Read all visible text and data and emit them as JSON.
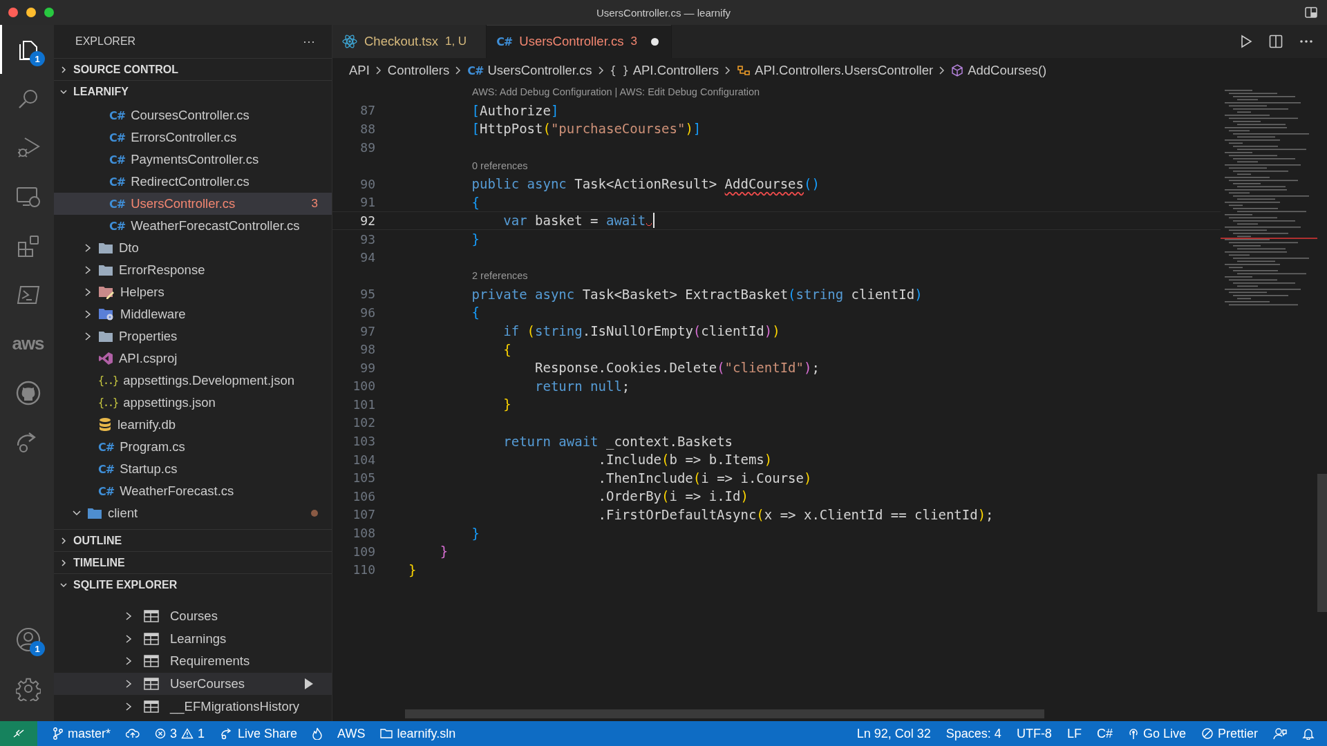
{
  "window": {
    "title": "UsersController.cs — learnify"
  },
  "activity_bar": {
    "top": [
      {
        "kind": "explorer",
        "selected": true,
        "badge": "1"
      },
      {
        "kind": "search",
        "selected": false
      },
      {
        "kind": "debug",
        "selected": false
      },
      {
        "kind": "remote",
        "selected": false
      },
      {
        "kind": "extensions",
        "selected": false
      },
      {
        "kind": "terminal",
        "selected": false
      },
      {
        "kind": "aws",
        "label": "aws",
        "selected": false
      },
      {
        "kind": "github",
        "selected": false
      },
      {
        "kind": "liveshare",
        "selected": false
      }
    ],
    "bottom": [
      {
        "kind": "account",
        "selected": false,
        "badge": "1"
      },
      {
        "kind": "settings",
        "selected": false
      }
    ]
  },
  "sidebar": {
    "title": "EXPLORER",
    "more": "···",
    "sections": [
      {
        "title": "SOURCE CONTROL",
        "expanded": false
      },
      {
        "title": "LEARNIFY",
        "expanded": true,
        "kind": "files",
        "tree": [
          {
            "kind": "group",
            "children": [
              {
                "kind": "group",
                "children": [
                  {
                    "label": "CoursesController.cs",
                    "kind": "cs",
                    "icon_text": "C#",
                    "selected": false
                  },
                  {
                    "label": "ErrorsController.cs",
                    "kind": "cs",
                    "icon_text": "C#",
                    "selected": false
                  },
                  {
                    "label": "PaymentsController.cs",
                    "kind": "cs",
                    "icon_text": "C#",
                    "selected": false
                  },
                  {
                    "label": "RedirectController.cs",
                    "kind": "cs",
                    "icon_text": "C#",
                    "selected": false
                  },
                  {
                    "label": "UsersController.cs",
                    "kind": "cs",
                    "icon_text": "C#",
                    "selected": true,
                    "errors": "3"
                  },
                  {
                    "label": "WeatherForecastController.cs",
                    "kind": "cs",
                    "icon_text": "C#",
                    "selected": false
                  }
                ]
              },
              {
                "label": "Dto",
                "kind": "folder",
                "expanded": false,
                "selected": false
              },
              {
                "label": "ErrorResponse",
                "kind": "folder",
                "expanded": false,
                "selected": false
              },
              {
                "label": "Helpers",
                "kind": "folder-helpers",
                "expanded": false,
                "selected": false
              },
              {
                "label": "Middleware",
                "kind": "folder-middleware",
                "expanded": false,
                "selected": false
              },
              {
                "label": "Properties",
                "kind": "folder",
                "expanded": false,
                "selected": false
              },
              {
                "label": "API.csproj",
                "kind": "csproj",
                "selected": false
              },
              {
                "label": "appsettings.Development.json",
                "kind": "json",
                "icon_text": "{..}",
                "selected": false
              },
              {
                "label": "appsettings.json",
                "kind": "json",
                "icon_text": "{..}",
                "selected": false
              },
              {
                "label": "learnify.db",
                "kind": "db",
                "selected": false
              },
              {
                "label": "Program.cs",
                "kind": "cs",
                "icon_text": "C#",
                "selected": false
              },
              {
                "label": "Startup.cs",
                "kind": "cs",
                "icon_text": "C#",
                "selected": false
              },
              {
                "label": "WeatherForecast.cs",
                "kind": "cs",
                "icon_text": "C#",
                "selected": false
              }
            ]
          },
          {
            "label": "client",
            "kind": "folder-client",
            "expanded": true,
            "selected": false,
            "modified": true
          }
        ]
      },
      {
        "title": "OUTLINE",
        "expanded": false
      },
      {
        "title": "TIMELINE",
        "expanded": false
      },
      {
        "title": "SQLITE EXPLORER",
        "expanded": true,
        "kind": "tables",
        "tables": [
          {
            "label": "Courses",
            "selected": false
          },
          {
            "label": "Learnings",
            "selected": false
          },
          {
            "label": "Requirements",
            "selected": false
          },
          {
            "label": "UserCourses",
            "selected": true
          },
          {
            "label": "__EFMigrationsHistory",
            "selected": false
          }
        ]
      }
    ]
  },
  "tabs": [
    {
      "label": "Checkout.tsx",
      "kind": "react",
      "status": "1, U",
      "color": "#d7ba7d",
      "selected": false,
      "dirty": false
    },
    {
      "label": "UsersController.cs",
      "kind": "cs",
      "icon_text": "C#",
      "status": "3",
      "color": "#f48771",
      "selected": true,
      "dirty": true
    }
  ],
  "breadcrumbs": [
    {
      "label": "API",
      "kind": "none"
    },
    {
      "label": "Controllers",
      "kind": "none"
    },
    {
      "label": "UsersController.cs",
      "kind": "cs",
      "icon_text": "C#"
    },
    {
      "label": "API.Controllers",
      "kind": "namespace",
      "icon_text": "{ }"
    },
    {
      "label": "API.Controllers.UsersController",
      "kind": "class"
    },
    {
      "label": "AddCourses()",
      "kind": "method"
    }
  ],
  "code": [
    {
      "kind": "lens",
      "text": "AWS: Add Debug Configuration | AWS: Edit Debug Configuration"
    },
    {
      "kind": "line",
      "number": "87",
      "current": false,
      "tokens": [
        {
          "text": "        [",
          "kind": "b3"
        },
        {
          "text": "Authorize",
          "kind": "p"
        },
        {
          "text": "]",
          "kind": "b3"
        }
      ]
    },
    {
      "kind": "line",
      "number": "88",
      "current": false,
      "tokens": [
        {
          "text": "        [",
          "kind": "b3"
        },
        {
          "text": "HttpPost",
          "kind": "p"
        },
        {
          "text": "(",
          "kind": "b1"
        },
        {
          "text": "\"purchaseCourses\"",
          "kind": "s"
        },
        {
          "text": ")",
          "kind": "b1"
        },
        {
          "text": "]",
          "kind": "b3"
        }
      ]
    },
    {
      "kind": "line",
      "number": "89",
      "current": false
    },
    {
      "kind": "lens",
      "text": "0 references"
    },
    {
      "kind": "line",
      "number": "90",
      "current": false,
      "tokens": [
        {
          "text": "        public async",
          "kind": "k"
        },
        {
          "text": " Task<ActionResult> ",
          "kind": "p"
        },
        {
          "text": "AddCourses",
          "kind": "e"
        },
        {
          "text": "()",
          "kind": "b3"
        }
      ]
    },
    {
      "kind": "line",
      "number": "91",
      "current": false,
      "tokens": [
        {
          "text": "        {",
          "kind": "b3"
        }
      ]
    },
    {
      "kind": "line",
      "number": "92",
      "current": true,
      "error": true,
      "tokens": [
        {
          "text": "            var",
          "kind": "k"
        },
        {
          "text": " basket = ",
          "kind": "p"
        },
        {
          "text": "await",
          "kind": "k"
        }
      ]
    },
    {
      "kind": "line",
      "number": "93",
      "current": false,
      "tokens": [
        {
          "text": "        }",
          "kind": "b3"
        }
      ]
    },
    {
      "kind": "line",
      "number": "94",
      "current": false
    },
    {
      "kind": "lens",
      "text": "2 references"
    },
    {
      "kind": "line",
      "number": "95",
      "current": false,
      "tokens": [
        {
          "text": "        private async",
          "kind": "k"
        },
        {
          "text": " Task<Basket> ExtractBasket",
          "kind": "p"
        },
        {
          "text": "(",
          "kind": "b3"
        },
        {
          "text": "string",
          "kind": "k"
        },
        {
          "text": " clientId",
          "kind": "p"
        },
        {
          "text": ")",
          "kind": "b3"
        }
      ]
    },
    {
      "kind": "line",
      "number": "96",
      "current": false,
      "tokens": [
        {
          "text": "        {",
          "kind": "b3"
        }
      ]
    },
    {
      "kind": "line",
      "number": "97",
      "current": false,
      "tokens": [
        {
          "text": "            if ",
          "kind": "k"
        },
        {
          "text": "(",
          "kind": "b1"
        },
        {
          "text": "string",
          "kind": "k"
        },
        {
          "text": ".IsNullOrEmpty",
          "kind": "p"
        },
        {
          "text": "(",
          "kind": "b2"
        },
        {
          "text": "clientId",
          "kind": "p"
        },
        {
          "text": ")",
          "kind": "b2"
        },
        {
          "text": ")",
          "kind": "b1"
        }
      ]
    },
    {
      "kind": "line",
      "number": "98",
      "current": false,
      "tokens": [
        {
          "text": "            {",
          "kind": "b1"
        }
      ]
    },
    {
      "kind": "line",
      "number": "99",
      "current": false,
      "tokens": [
        {
          "text": "                Response.Cookies.Delete",
          "kind": "p"
        },
        {
          "text": "(",
          "kind": "b2"
        },
        {
          "text": "\"clientId\"",
          "kind": "s"
        },
        {
          "text": ")",
          "kind": "b2"
        },
        {
          "text": ";",
          "kind": "p"
        }
      ]
    },
    {
      "kind": "line",
      "number": "100",
      "current": false,
      "tokens": [
        {
          "text": "                return null",
          "kind": "k"
        },
        {
          "text": ";",
          "kind": "p"
        }
      ]
    },
    {
      "kind": "line",
      "number": "101",
      "current": false,
      "tokens": [
        {
          "text": "            }",
          "kind": "b1"
        }
      ]
    },
    {
      "kind": "line",
      "number": "102",
      "current": false
    },
    {
      "kind": "line",
      "number": "103",
      "current": false,
      "tokens": [
        {
          "text": "            return await",
          "kind": "k"
        },
        {
          "text": " _context.Baskets",
          "kind": "p"
        }
      ]
    },
    {
      "kind": "line",
      "number": "104",
      "current": false,
      "tokens": [
        {
          "text": "                        .Include",
          "kind": "p"
        },
        {
          "text": "(",
          "kind": "b1"
        },
        {
          "text": "b => b.Items",
          "kind": "p"
        },
        {
          "text": ")",
          "kind": "b1"
        }
      ]
    },
    {
      "kind": "line",
      "number": "105",
      "current": false,
      "tokens": [
        {
          "text": "                        .ThenInclude",
          "kind": "p"
        },
        {
          "text": "(",
          "kind": "b1"
        },
        {
          "text": "i => i.Course",
          "kind": "p"
        },
        {
          "text": ")",
          "kind": "b1"
        }
      ]
    },
    {
      "kind": "line",
      "number": "106",
      "current": false,
      "tokens": [
        {
          "text": "                        .OrderBy",
          "kind": "p"
        },
        {
          "text": "(",
          "kind": "b1"
        },
        {
          "text": "i => i.Id",
          "kind": "p"
        },
        {
          "text": ")",
          "kind": "b1"
        }
      ]
    },
    {
      "kind": "line",
      "number": "107",
      "current": false,
      "tokens": [
        {
          "text": "                        .FirstOrDefaultAsync",
          "kind": "p"
        },
        {
          "text": "(",
          "kind": "b1"
        },
        {
          "text": "x => x.ClientId == clientId",
          "kind": "p"
        },
        {
          "text": ")",
          "kind": "b1"
        },
        {
          "text": ";",
          "kind": "p"
        }
      ]
    },
    {
      "kind": "line",
      "number": "108",
      "current": false,
      "tokens": [
        {
          "text": "        }",
          "kind": "b3"
        }
      ]
    },
    {
      "kind": "line",
      "number": "109",
      "current": false,
      "tokens": [
        {
          "text": "    }",
          "kind": "b2"
        }
      ]
    },
    {
      "kind": "line",
      "number": "110",
      "current": false,
      "tokens": [
        {
          "text": "}",
          "kind": "b1"
        }
      ]
    }
  ],
  "status_bar": {
    "left": [
      {
        "kind": "remote"
      },
      {
        "kind": "branch",
        "label": "master*"
      },
      {
        "kind": "sync"
      },
      {
        "kind": "problems",
        "errors": "3",
        "warnings": "1"
      },
      {
        "kind": "liveshare",
        "label": "Live Share"
      },
      {
        "kind": "flame"
      },
      {
        "kind": "text",
        "label": "AWS"
      },
      {
        "kind": "solution",
        "label": "learnify.sln"
      }
    ],
    "right": [
      {
        "kind": "text",
        "label": "Ln 92, Col 32"
      },
      {
        "kind": "text",
        "label": "Spaces: 4"
      },
      {
        "kind": "text",
        "label": "UTF-8"
      },
      {
        "kind": "text",
        "label": "LF"
      },
      {
        "kind": "text",
        "label": "C#"
      },
      {
        "kind": "golive",
        "label": "Go Live"
      },
      {
        "kind": "prettier",
        "label": "Prettier"
      },
      {
        "kind": "feedback"
      },
      {
        "kind": "bell"
      }
    ]
  }
}
